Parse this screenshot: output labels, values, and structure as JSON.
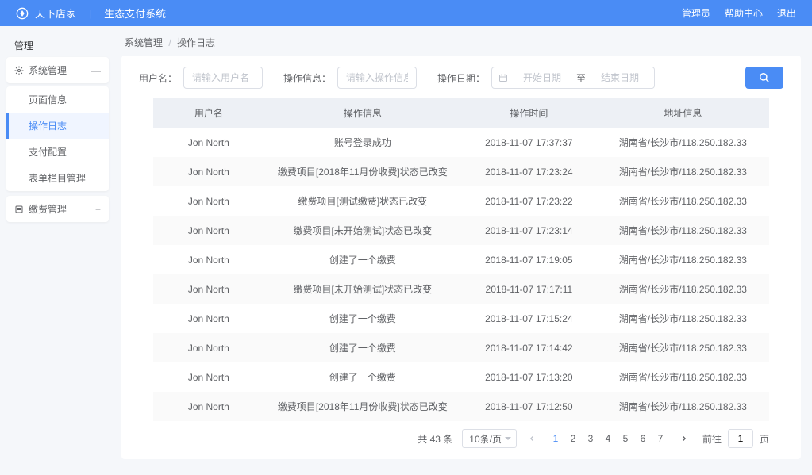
{
  "header": {
    "brand": "天下店家",
    "divider": "|",
    "title": "生态支付系统",
    "links": {
      "admin": "管理员",
      "help": "帮助中心",
      "logout": "退出"
    }
  },
  "sidebar": {
    "root_label": "管理",
    "group1": {
      "label": "系统管理",
      "collapse_icon": "—"
    },
    "items": {
      "page_info": "页面信息",
      "op_log": "操作日志",
      "pay_config": "支付配置",
      "table_col_mgmt": "表单栏目管理"
    },
    "group2": {
      "label": "缴费管理",
      "expand_icon": "+"
    }
  },
  "breadcrumb": {
    "a": "系统管理",
    "sep": "/",
    "b": "操作日志"
  },
  "filters": {
    "username_label": "用户名：",
    "username_placeholder": "请输入用户名",
    "opinfo_label": "操作信息：",
    "opinfo_placeholder": "请输入操作信息",
    "date_label": "操作日期：",
    "date_start_placeholder": "开始日期",
    "date_sep": "至",
    "date_end_placeholder": "结束日期"
  },
  "table": {
    "headers": {
      "user": "用户名",
      "op": "操作信息",
      "time": "操作时间",
      "addr": "地址信息"
    },
    "rows": [
      {
        "user": "Jon North",
        "op": "账号登录成功",
        "time": "2018-11-07 17:37:37",
        "addr": "湖南省/长沙市/118.250.182.33"
      },
      {
        "user": "Jon North",
        "op": "缴费项目[2018年11月份收费]状态已改变",
        "time": "2018-11-07 17:23:24",
        "addr": "湖南省/长沙市/118.250.182.33"
      },
      {
        "user": "Jon North",
        "op": "缴费项目[测试缴费]状态已改变",
        "time": "2018-11-07 17:23:22",
        "addr": "湖南省/长沙市/118.250.182.33"
      },
      {
        "user": "Jon North",
        "op": "缴费项目[未开始测试]状态已改变",
        "time": "2018-11-07 17:23:14",
        "addr": "湖南省/长沙市/118.250.182.33"
      },
      {
        "user": "Jon North",
        "op": "创建了一个缴费",
        "time": "2018-11-07 17:19:05",
        "addr": "湖南省/长沙市/118.250.182.33"
      },
      {
        "user": "Jon North",
        "op": "缴费项目[未开始测试]状态已改变",
        "time": "2018-11-07 17:17:11",
        "addr": "湖南省/长沙市/118.250.182.33"
      },
      {
        "user": "Jon North",
        "op": "创建了一个缴费",
        "time": "2018-11-07 17:15:24",
        "addr": "湖南省/长沙市/118.250.182.33"
      },
      {
        "user": "Jon North",
        "op": "创建了一个缴费",
        "time": "2018-11-07 17:14:42",
        "addr": "湖南省/长沙市/118.250.182.33"
      },
      {
        "user": "Jon North",
        "op": "创建了一个缴费",
        "time": "2018-11-07 17:13:20",
        "addr": "湖南省/长沙市/118.250.182.33"
      },
      {
        "user": "Jon North",
        "op": "缴费项目[2018年11月份收费]状态已改变",
        "time": "2018-11-07 17:12:50",
        "addr": "湖南省/长沙市/118.250.182.33"
      }
    ]
  },
  "pagination": {
    "total_text": "共 43 条",
    "page_size": "10条/页",
    "pages": [
      "1",
      "2",
      "3",
      "4",
      "5",
      "6",
      "7"
    ],
    "goto_label": "前往",
    "goto_value": "1",
    "goto_suffix": "页"
  }
}
